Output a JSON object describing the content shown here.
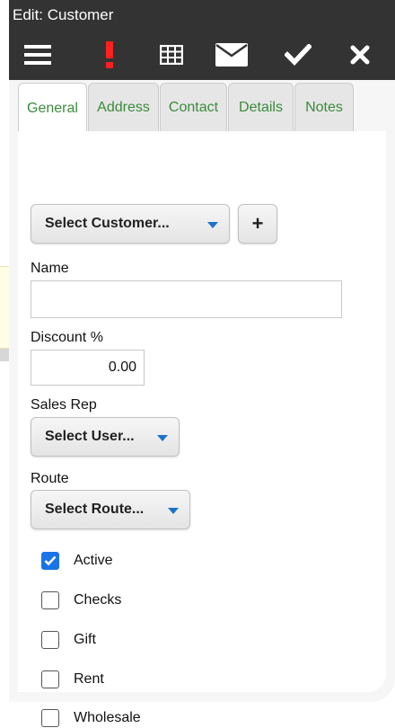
{
  "window": {
    "title": "Edit: Customer"
  },
  "toolbar": {
    "icons": [
      "menu-icon",
      "exclamation-icon",
      "grid-icon",
      "envelope-icon",
      "check-icon",
      "close-icon"
    ],
    "alert_color": "#ff2020"
  },
  "tabs": [
    {
      "label": "General",
      "active": true
    },
    {
      "label": "Address",
      "active": false
    },
    {
      "label": "Contact",
      "active": false
    },
    {
      "label": "Details",
      "active": false
    },
    {
      "label": "Notes",
      "active": false
    }
  ],
  "customer_select": {
    "label": "Select Customer...",
    "add_label": "+"
  },
  "name": {
    "label": "Name",
    "value": ""
  },
  "discount": {
    "label": "Discount %",
    "value": "0.00"
  },
  "sales_rep": {
    "label": "Sales Rep",
    "select_label": "Select User..."
  },
  "route": {
    "label": "Route",
    "select_label": "Select Route..."
  },
  "checkboxes": [
    {
      "label": "Active",
      "checked": true
    },
    {
      "label": "Checks",
      "checked": false
    },
    {
      "label": "Gift",
      "checked": false
    },
    {
      "label": "Rent",
      "checked": false
    },
    {
      "label": "Wholesale",
      "checked": false
    }
  ],
  "colors": {
    "tab_text": "#3c8a3c",
    "caret": "#1a73c9",
    "check_accent": "#1a73e8",
    "toolbar_bg": "#333333"
  }
}
